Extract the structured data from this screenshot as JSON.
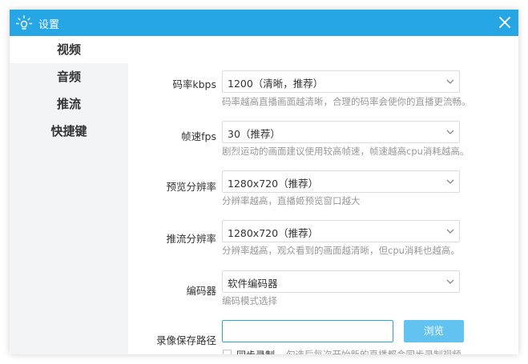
{
  "titlebar": {
    "title": "设置",
    "icon": "lightbulb-icon",
    "close_icon": "close-icon"
  },
  "sidebar": {
    "items": [
      {
        "label": "视频",
        "active": true
      },
      {
        "label": "音频",
        "active": false
      },
      {
        "label": "推流",
        "active": false
      },
      {
        "label": "快捷键",
        "active": false
      }
    ]
  },
  "settings": {
    "bitrate": {
      "label": "码率kbps",
      "value": "1200（清晰，推荐）",
      "hint": "码率越高直播画面越清晰，合理的码率会使你的直播更流畅。"
    },
    "fps": {
      "label": "帧速fps",
      "value": "30（推荐）",
      "hint": "剧烈运动的画面建议使用较高帧速，帧速越高cpu消耗越高。"
    },
    "preview_resolution": {
      "label": "预览分辨率",
      "value": "1280x720（推荐）",
      "hint": "分辨率越高，直播姬预览窗口越大"
    },
    "stream_resolution": {
      "label": "推流分辨率",
      "value": "1280x720（推荐）",
      "hint": "分辨率越高，观众看到的画面越清晰，但cpu消耗也越高。"
    },
    "encoder": {
      "label": "编码器",
      "value": "软件编码器",
      "hint": "编码模式选择"
    },
    "record_path": {
      "label": "录像保存路径",
      "value": "",
      "browse_label": "浏览",
      "sync_label": "同步录制",
      "sync_checked": false,
      "sync_hint": "勾选后每次开始新的直播都会同步录制视频"
    }
  },
  "colors": {
    "accent": "#27a6e6",
    "button": "#62c3f0",
    "sidebar_bg": "#f3f4f5",
    "hint_text": "#999999"
  }
}
